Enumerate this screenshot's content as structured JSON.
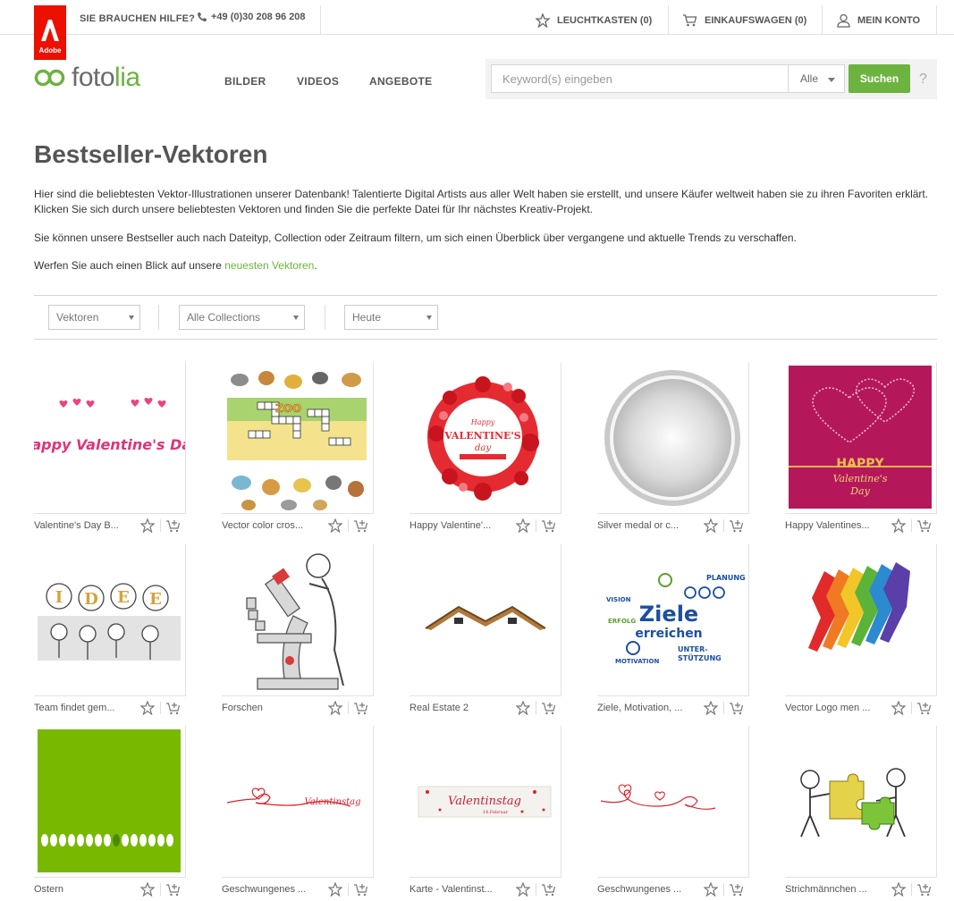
{
  "topbar": {
    "help_label": "SIE BRAUCHEN HILFE?",
    "phone": "+49 (0)30 208 96 208",
    "lightbox_label": "LEUCHTKASTEN (0)",
    "cart_label": "EINKAUFSWAGEN (0)",
    "account_label": "MEIN KONTO",
    "adobe_label": "Adobe",
    "adobe_color": "#eb1000"
  },
  "header": {
    "logo_text": "fotolia",
    "nav": [
      "BILDER",
      "VIDEOS",
      "ANGEBOTE"
    ],
    "search": {
      "placeholder": "Keyword(s) eingeben",
      "scope": "Alle",
      "button": "Suchen",
      "help": "?"
    },
    "accent_color": "#6cb33f"
  },
  "main": {
    "title": "Bestseller-Vektoren",
    "intro": "Hier sind die beliebtesten Vektor-Illustrationen unserer Datenbank! Talentierte Digital Artists aus aller Welt haben sie erstellt, und unsere Käufer weltweit haben sie zu ihren Favoriten erklärt. Klicken Sie sich durch unsere beliebtesten Vektoren und finden Sie die perfekte Datei für Ihr nächstes Kreativ-Projekt.",
    "filter_note": "Sie können unsere Bestseller auch nach Dateityp, Collection oder Zeitraum filtern, um sich einen Überblick über vergangene und aktuelle Trends zu verschaffen.",
    "link_prefix": "Werfen Sie auch einen Blick auf unsere ",
    "link_text": "neuesten Vektoren",
    "link_suffix": "."
  },
  "filters": {
    "type": "Vektoren",
    "collection": "Alle Collections",
    "period": "Heute"
  },
  "grid": [
    {
      "caption": "Valentine's Day B...",
      "icon": "valentines-text"
    },
    {
      "caption": "Vector color cros...",
      "icon": "zoo-crossword"
    },
    {
      "caption": "Happy Valentine'...",
      "icon": "hearts-wreath"
    },
    {
      "caption": "Silver medal or c...",
      "icon": "silver-medal"
    },
    {
      "caption": "Happy Valentines...",
      "icon": "pink-card"
    },
    {
      "caption": "Team findet gem...",
      "icon": "idee-team"
    },
    {
      "caption": "Forschen",
      "icon": "microscope"
    },
    {
      "caption": "Real Estate 2",
      "icon": "roof-logo"
    },
    {
      "caption": "Ziele, Motivation, ...",
      "icon": "ziele-doodle"
    },
    {
      "caption": "Vector Logo men ...",
      "icon": "rainbow-runners"
    },
    {
      "caption": "Ostern",
      "icon": "easter-green"
    },
    {
      "caption": "Geschwungenes ...",
      "icon": "swirl-valentinstag"
    },
    {
      "caption": "Karte - Valentinst...",
      "icon": "valentinstag-card"
    },
    {
      "caption": "Geschwungenes ...",
      "icon": "heart-swirl"
    },
    {
      "caption": "Strichmännchen ...",
      "icon": "puzzle-people"
    }
  ]
}
